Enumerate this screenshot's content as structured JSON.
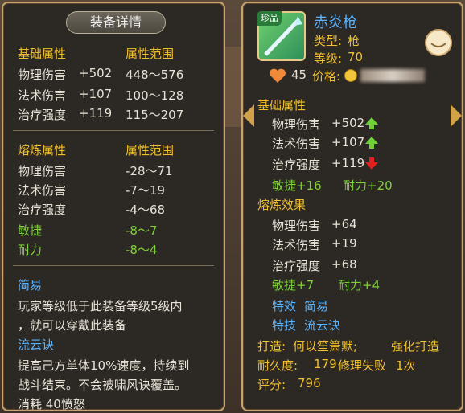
{
  "left": {
    "title": "装备详情",
    "base_header": "基础属性",
    "range_header": "属性范围",
    "base_rows": [
      {
        "name": "物理伤害",
        "value": "+502",
        "range": "448～576"
      },
      {
        "name": "法术伤害",
        "value": "+107",
        "range": "100～128"
      },
      {
        "name": "治疗强度",
        "value": "+119",
        "range": "115～207"
      }
    ],
    "refine_header": "熔炼属性",
    "refine_range_header": "属性范围",
    "refine_rows": [
      {
        "name": "物理伤害",
        "range": "-28～71"
      },
      {
        "name": "法术伤害",
        "range": "-7～19"
      },
      {
        "name": "治疗强度",
        "range": "-4～68"
      },
      {
        "name": "敏捷",
        "range": "-8～7"
      },
      {
        "name": "耐力",
        "range": "-8～4"
      }
    ],
    "effect_name": "简易",
    "effect_desc_1": "玩家等级低于此装备等级5级内",
    "effect_desc_2": "，就可以穿戴此装备",
    "skill_name": "流云诀",
    "skill_desc_1": "提高己方单体10%速度，持续到",
    "skill_desc_2": "战斗结束。不会被啸风诀覆盖。",
    "skill_cost": "消耗 40愤怒"
  },
  "right": {
    "item_name": "赤炎枪",
    "rarity_badge": "珍品",
    "type_label": "类型:",
    "type_value": "枪",
    "level_label": "等级:",
    "level_value": "70",
    "heart_count": "45",
    "price_label": "价格:",
    "base_header": "基础属性",
    "base_rows": [
      {
        "name": "物理伤害",
        "value": "+502",
        "trend": "up"
      },
      {
        "name": "法术伤害",
        "value": "+107",
        "trend": "up"
      },
      {
        "name": "治疗强度",
        "value": "+119",
        "trend": "down"
      }
    ],
    "agi": "敏捷+16",
    "sta": "耐力+20",
    "refine_header": "熔炼效果",
    "refine_rows": [
      {
        "name": "物理伤害",
        "value": "+64"
      },
      {
        "name": "法术伤害",
        "value": "+19"
      },
      {
        "name": "治疗强度",
        "value": "+68"
      }
    ],
    "refine_agi": "敏捷+7",
    "refine_sta": "耐力+4",
    "effect_label": "特效",
    "effect_value": "简易",
    "skill_label": "特技",
    "skill_value": "流云诀",
    "maker_label": "打造:",
    "maker_value": "何以笙箫默;",
    "enhance": "强化打造",
    "durability_label": "耐久度:",
    "durability_value": "179",
    "repair_fail": "修理失败",
    "repair_count": "1次",
    "score_label": "评分:",
    "score_value": "796"
  },
  "colors": {
    "gold": "#f0c030",
    "green": "#7fd13a",
    "blue": "#5ab4ff",
    "border": "#c9a36b"
  }
}
